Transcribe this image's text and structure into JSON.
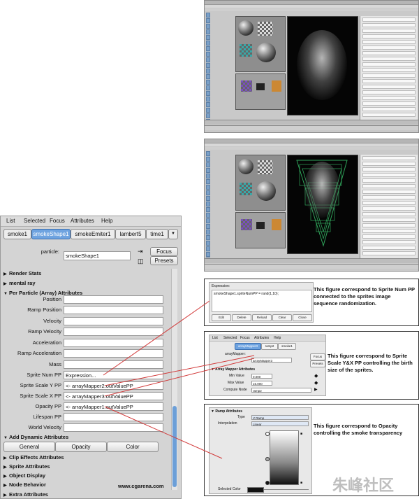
{
  "attribute_editor": {
    "menu": [
      "List",
      "Selected",
      "Focus",
      "Attributes",
      "Help"
    ],
    "tabs": [
      {
        "label": "smoke1",
        "active": false
      },
      {
        "label": "smokeShape1",
        "active": true
      },
      {
        "label": "smokeEmiter1",
        "active": false
      },
      {
        "label": "lambert5",
        "active": false
      },
      {
        "label": "time1",
        "active": false
      }
    ],
    "particle_label": "particle:",
    "particle_value": "smokeShape1",
    "focus_label": "Focus",
    "presets_label": "Presets",
    "sections": {
      "render_stats": "Render Stats",
      "mental_ray": "mental ray",
      "per_particle": "Per Particle (Array) Attributes",
      "add_dynamic": "Add Dynamic Attributes",
      "clip_effects": "Clip Effects Attributes",
      "sprite": "Sprite Attributes",
      "object_display": "Object Display",
      "node_behavior": "Node Behavior",
      "extra": "Extra Attributes"
    },
    "pp_rows": [
      {
        "label": "Position",
        "value": ""
      },
      {
        "label": "Ramp Position",
        "value": ""
      },
      {
        "label": "Velocity",
        "value": ""
      },
      {
        "label": "Ramp Velocity",
        "value": ""
      },
      {
        "label": "Acceleration",
        "value": ""
      },
      {
        "label": "Ramp Acceleration",
        "value": ""
      },
      {
        "label": "Mass",
        "value": ""
      },
      {
        "label": "Sprite Num PP",
        "value": "Expression..."
      },
      {
        "label": "Sprite Scale Y PP",
        "value": "<- arrayMapper2.outValuePP"
      },
      {
        "label": "Sprite Scale X PP",
        "value": "<- arrayMapper3.outValuePP"
      },
      {
        "label": "Opacity PP",
        "value": "<- arrayMapper1.outValuePP"
      },
      {
        "label": "Lifespan PP",
        "value": ""
      },
      {
        "label": "World Velocity",
        "value": ""
      }
    ],
    "dyn_buttons": [
      "General",
      "Opacity",
      "Color"
    ],
    "credit": "www.cgarena.com"
  },
  "callouts": {
    "expression": {
      "title": "Expression:",
      "code": "smokeShape1.spriteNumPP = rand(1,10);",
      "buttons": [
        "Edit",
        "Delete",
        "Reload",
        "Clear",
        "Close"
      ],
      "caption": "This figure correspond to Sprite Num PP connected to the sprites image sequence randomization."
    },
    "array_mapper": {
      "menu": [
        "List",
        "Selected",
        "Focus",
        "Attributes",
        "Help"
      ],
      "tabs": [
        "arrayMapper3",
        "ramp2",
        "smoke1"
      ],
      "node_label": "arrayMapper:",
      "node_value": "arrayMapper3",
      "focus_label": "Focus",
      "presets_label": "Presets",
      "section": "Array Mapper Attributes",
      "min_label": "Min Value",
      "min_value": "0.000",
      "max_label": "Max Value",
      "max_value": "15.000",
      "compute_label": "Compute Node",
      "compute_value": "ramp2",
      "caption": "This figure correspond to Sprite Scale Y&X PP controlling the birth size of the sprites."
    },
    "ramp": {
      "section": "Ramp Attributes",
      "type_label": "Type",
      "type_value": "V Ramp",
      "interp_label": "Interpolation",
      "interp_value": "Linear",
      "selected_color_label": "Selected Color",
      "caption": "This figure correspond to Opacity controlling the smoke transparency"
    }
  },
  "watermark": "朱峰社区",
  "colors": {
    "tab_active": "#6ea3e0",
    "connector": "#d23a3a",
    "scroll_thumb": "#6c9fd8"
  }
}
